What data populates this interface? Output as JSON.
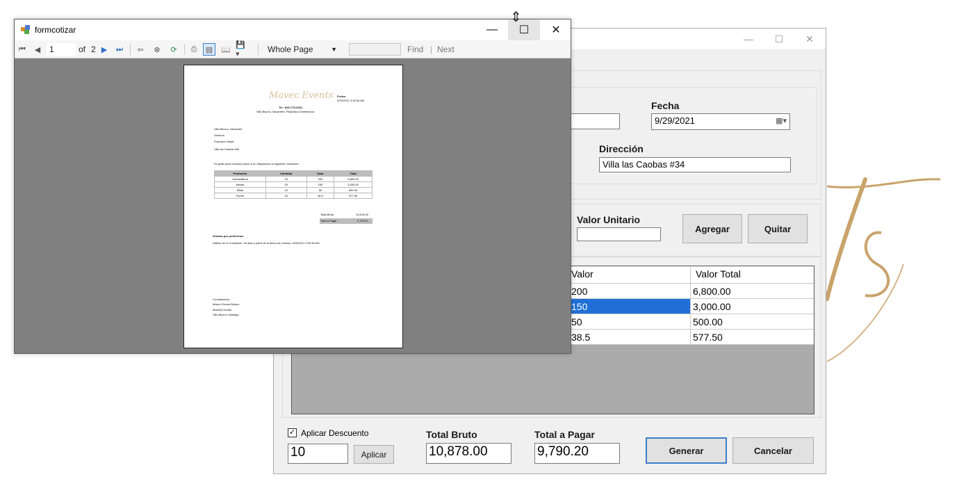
{
  "report_viewer": {
    "title": "formcotizar",
    "toolbar": {
      "page_current": "1",
      "page_of": "of",
      "page_total": "2",
      "zoom": "Whole Page",
      "find_text": "",
      "find_label": "Find",
      "next_label": "Next"
    },
    "page": {
      "logo_text": "Mavec Events",
      "fecha_label": "Fecha:",
      "fecha_value": "9/29/2021 9:39:36 AM",
      "contact_line": "Tel.: 829-778-3152",
      "address_line": "Villa Bisono, Navarrete, Republica Dominicana",
      "to_lines": [
        "Villa Bisono, Navarrete",
        "Señores",
        "Francisco Mejia",
        "Villa las Caobas #34"
      ],
      "intro": "Es grato para nosotros poner a su disposicion la siguiente cotizacion:",
      "table": {
        "headers": [
          "Productos",
          "Cantidad",
          "Valor",
          "Total"
        ],
        "rows": [
          [
            "Candelabros",
            "34",
            "200",
            "6,800.00"
          ],
          [
            "Mesas",
            "20",
            "150",
            "3,000.00"
          ],
          [
            "Sillas",
            "10",
            "50",
            "500.00"
          ],
          [
            "Flores",
            "15",
            "38.5",
            "577.50"
          ]
        ]
      },
      "total_bruto_label": "Total Bruto",
      "total_bruto_value": "10,878.00",
      "total_pagar_label": "Total a Pagar",
      "total_pagar_value": "9,790.20",
      "thanks": "Gracias por preferirnos",
      "validity": "Validez de la Cotizacion: 30 dias a partir de la fecha de emision: 9/29/2021 9:39:36 AM",
      "sign_lines": [
        "Cordialmente,",
        "Mavec Events Bisono",
        "Marbely Duarte",
        "Villa Bisono Santiago"
      ]
    }
  },
  "main_form": {
    "fecha_label": "Fecha",
    "fecha_value": "9/29/2021",
    "direccion_label": "Dirección",
    "direccion_value": "Villa las Caobas #34",
    "valor_unitario_label": "Valor Unitario",
    "valor_unitario_value": "",
    "agregar_label": "Agregar",
    "quitar_label": "Quitar",
    "grid": {
      "headers": [
        "Valor",
        "Valor Total"
      ],
      "rows": [
        {
          "valor": "200",
          "total": "6,800.00"
        },
        {
          "valor": "150",
          "total": "3,000.00"
        },
        {
          "valor": "50",
          "total": "500.00"
        },
        {
          "valor": "38.5",
          "total": "577.50"
        }
      ]
    },
    "aplicar_descuento_label": "Aplicar Descuento",
    "descuento_value": "10",
    "aplicar_label": "Aplicar",
    "total_bruto_label": "Total Bruto",
    "total_bruto_value": "10,878.00",
    "total_pagar_label": "Total a Pagar",
    "total_pagar_value": "9,790.20",
    "generar_label": "Generar",
    "cancelar_label": "Cancelar"
  },
  "colors": {
    "accent_gold": "#c9a36b",
    "selection_blue": "#1f6fd6",
    "focus_border": "#3c7fc8"
  }
}
